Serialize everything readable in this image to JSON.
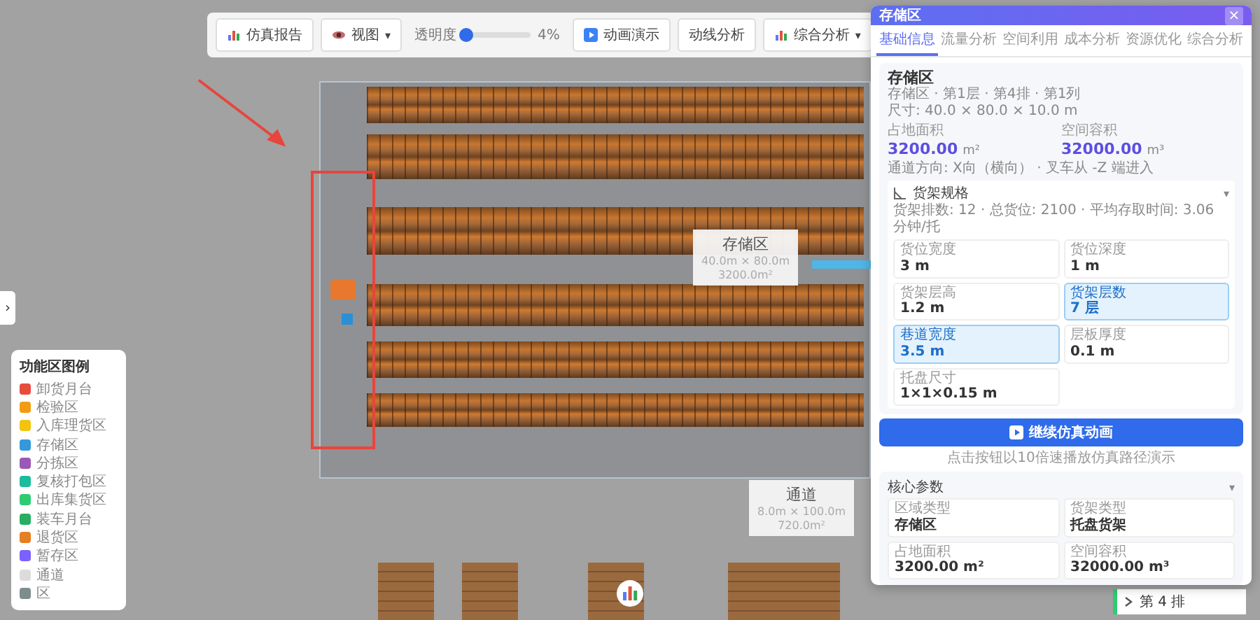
{
  "toolbar": {
    "items": [
      {
        "kind": "button",
        "label": "仿真报告"
      },
      {
        "kind": "dropdown",
        "label": "视图",
        "caret": "▾"
      },
      {
        "kind": "slider",
        "label": "透明度",
        "level": 0.05,
        "reading": "4%"
      },
      {
        "kind": "button",
        "label": "动画演示"
      },
      {
        "kind": "button",
        "label": "动线分析"
      },
      {
        "kind": "dropdown",
        "label": "综合分析",
        "caret": "▾"
      },
      {
        "kind": "primary"
      }
    ]
  },
  "sidebar_toggle": {
    "glyph": "›"
  },
  "scene": {
    "labels": [
      {
        "title": "存储区",
        "dims": "40.0m × 80.0m",
        "area": "3200.0m²"
      },
      {
        "title": "通道",
        "dims": "8.0m × 100.0m",
        "area": "720.0m²"
      }
    ]
  },
  "legend": {
    "title": "功能区图例",
    "items": [
      {
        "label": "卸货月台",
        "color": "#e74c3c"
      },
      {
        "label": "检验区",
        "color": "#f39c12"
      },
      {
        "label": "入库理货区",
        "color": "#f1c40f"
      },
      {
        "label": "存储区",
        "color": "#3498db"
      },
      {
        "label": "分拣区",
        "color": "#9b59b6"
      },
      {
        "label": "复核打包区",
        "color": "#1abc9c"
      },
      {
        "label": "出库集货区",
        "color": "#2ecc71"
      },
      {
        "label": "装车月台",
        "color": "#27ae60"
      },
      {
        "label": "退货区",
        "color": "#e67e22"
      },
      {
        "label": "暂存区",
        "color": "#7b61ff"
      },
      {
        "label": "通道",
        "color": "#dcdcdc"
      },
      {
        "label": "区",
        "color": "#7f8c8d"
      }
    ]
  },
  "panel": {
    "title": "存储区",
    "close": "×",
    "tabs": [
      {
        "label": "基础信息",
        "selected": true
      },
      {
        "label": "流量分析",
        "selected": false
      },
      {
        "label": "空间利用",
        "selected": false
      },
      {
        "label": "成本分析",
        "selected": false
      },
      {
        "label": "资源优化",
        "selected": false
      },
      {
        "label": "综合分析",
        "selected": false
      }
    ],
    "info": {
      "name": "存储区",
      "path": "存储区 · 第1层 · 第4排 · 第1列",
      "size": "尺寸: 40.0 × 80.0 × 10.0 m",
      "stats": [
        {
          "label": "占地面积",
          "value": "3200.00",
          "unit": "m²"
        },
        {
          "label": "空间容积",
          "value": "32000.00",
          "unit": "m³"
        }
      ],
      "note": "通道方向: X向（横向） · 叉车从 -Z 端进入"
    },
    "spec": {
      "title": "货架规格",
      "caret": "▾",
      "note": "货架排数: 12 · 总货位: 2100 · 平均存取时间: 3.06 分钟/托",
      "fields": [
        {
          "label": "货位宽度",
          "value": "3 m",
          "highlighted": false
        },
        {
          "label": "货位深度",
          "value": "1 m",
          "highlighted": false
        },
        {
          "label": "货架层高",
          "value": "1.2 m",
          "highlighted": false
        },
        {
          "label": "货架层数",
          "value": "7 层",
          "highlighted": true
        },
        {
          "label": "巷道宽度",
          "value": "3.5 m",
          "highlighted": true
        },
        {
          "label": "层板厚度",
          "value": "0.1 m",
          "highlighted": false
        },
        {
          "label": "托盘尺寸",
          "value": "1×1×0.15 m",
          "highlighted": false
        }
      ]
    },
    "action": {
      "label": "继续仿真动画"
    },
    "hint": "点击按钮以10倍速播放仿真路径演示",
    "core": {
      "title": "核心参数",
      "caret": "▾",
      "fields": [
        {
          "label": "区域类型",
          "value": "存储区"
        },
        {
          "label": "货架类型",
          "value": "托盘货架"
        },
        {
          "label": "占地面积",
          "value": "3200.00 m²"
        },
        {
          "label": "空间容积",
          "value": "32000.00 m³"
        }
      ]
    }
  },
  "row_list": {
    "items": [
      {
        "label": "第 4 排"
      }
    ]
  }
}
